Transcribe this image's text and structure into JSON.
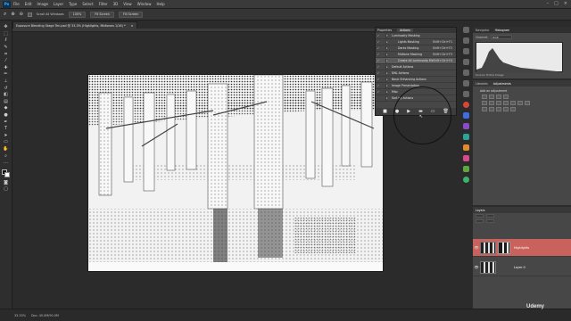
{
  "menubar": {
    "logo": "Ps",
    "items": [
      "File",
      "Edit",
      "Image",
      "Layer",
      "Type",
      "Select",
      "Filter",
      "3D",
      "View",
      "Window",
      "Help"
    ]
  },
  "options": {
    "checkbox_label": "Scroll All Windows",
    "zoom_value": "100%",
    "fit_button": "Fit Screen",
    "fill_button": "Fill Screen"
  },
  "document": {
    "tab_title": "Exposure Blending Stage Ten.psd @ 33.3% (Highlights, Midtones 1/16) *",
    "close": "×"
  },
  "actions_panel": {
    "tabs": [
      "Properties",
      "Actions"
    ],
    "rows": [
      {
        "check": "✓",
        "tri": "▾",
        "name": "Luminosity Masking",
        "shortcut": "",
        "sub": false,
        "selected": false
      },
      {
        "check": "✓",
        "tri": "▸",
        "name": "Lights Masking",
        "shortcut": "Shift+Ctrl+F1",
        "sub": true,
        "selected": false
      },
      {
        "check": "✓",
        "tri": "▸",
        "name": "Darks Masking",
        "shortcut": "Shift+Ctrl+F2",
        "sub": true,
        "selected": false
      },
      {
        "check": "✓",
        "tri": "▸",
        "name": "Midtone Masking",
        "shortcut": "Shift+Ctrl+F3",
        "sub": true,
        "selected": false
      },
      {
        "check": "✓",
        "tri": "▸",
        "name": "Create All Luminosity Ma...",
        "shortcut": "Shift+Ctrl+F4",
        "sub": true,
        "selected": true
      },
      {
        "check": "✓",
        "tri": "▸",
        "name": "Default Actions",
        "shortcut": "",
        "sub": false,
        "selected": false
      },
      {
        "check": "✓",
        "tri": "▸",
        "name": "DNL Actions",
        "shortcut": "",
        "sub": false,
        "selected": false
      },
      {
        "check": "✓",
        "tri": "▸",
        "name": "Basic Enhancing Actions",
        "shortcut": "",
        "sub": false,
        "selected": false
      },
      {
        "check": "✓",
        "tri": "▸",
        "name": "Image Presentation",
        "shortcut": "",
        "sub": false,
        "selected": false
      },
      {
        "check": "✓",
        "tri": "▸",
        "name": "Misc",
        "shortcut": "",
        "sub": false,
        "selected": false
      },
      {
        "check": "",
        "tri": "▸",
        "name": "Sort by Actions",
        "shortcut": "",
        "sub": false,
        "selected": false
      }
    ],
    "buttons": [
      "■",
      "●",
      "▶",
      "▬",
      "▭",
      "🗑"
    ]
  },
  "histogram_panel": {
    "tabs": [
      "Navigator",
      "Histogram"
    ],
    "channel_label": "Channel:",
    "channel_value": "RGB",
    "source_label": "Source:",
    "source_value": "Entire Image"
  },
  "adjustments_panel": {
    "tabs": [
      "Libraries",
      "Adjustments"
    ],
    "add_label": "Add an adjustment"
  },
  "layers_panel": {
    "tabs": [
      "Layers"
    ],
    "layers": [
      {
        "name": "Highlights",
        "selected": true
      },
      {
        "name": "Layer 0",
        "selected": false
      }
    ]
  },
  "statusbar": {
    "zoom": "33.33%",
    "doc": "Doc: 45.0M/90.0M"
  },
  "watermark": "Udemy",
  "colors": {
    "accent_layer": "#c9625c",
    "panel_bg": "#474747",
    "app_bg": "#2b2b2b"
  }
}
